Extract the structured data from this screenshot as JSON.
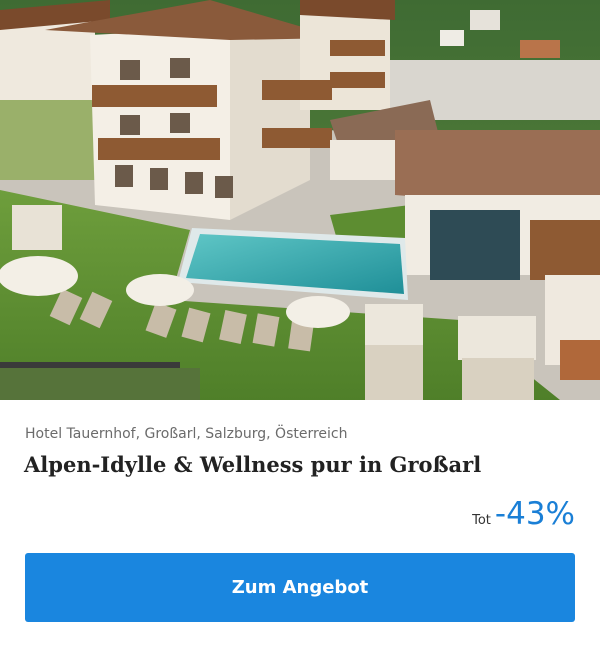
{
  "offer": {
    "photo_alt": "Hotel Tauernhof",
    "location": "Hotel Tauernhof, Großarl, Salzburg, Österreich",
    "title": "Alpen-Idylle & Wellness pur in Großarl",
    "discount_prefix": "Tot",
    "discount_value": "-43%",
    "cta_label": "Zum Angebot"
  },
  "colors": {
    "accent": "#1a86df",
    "discount": "#1a7fd6"
  }
}
